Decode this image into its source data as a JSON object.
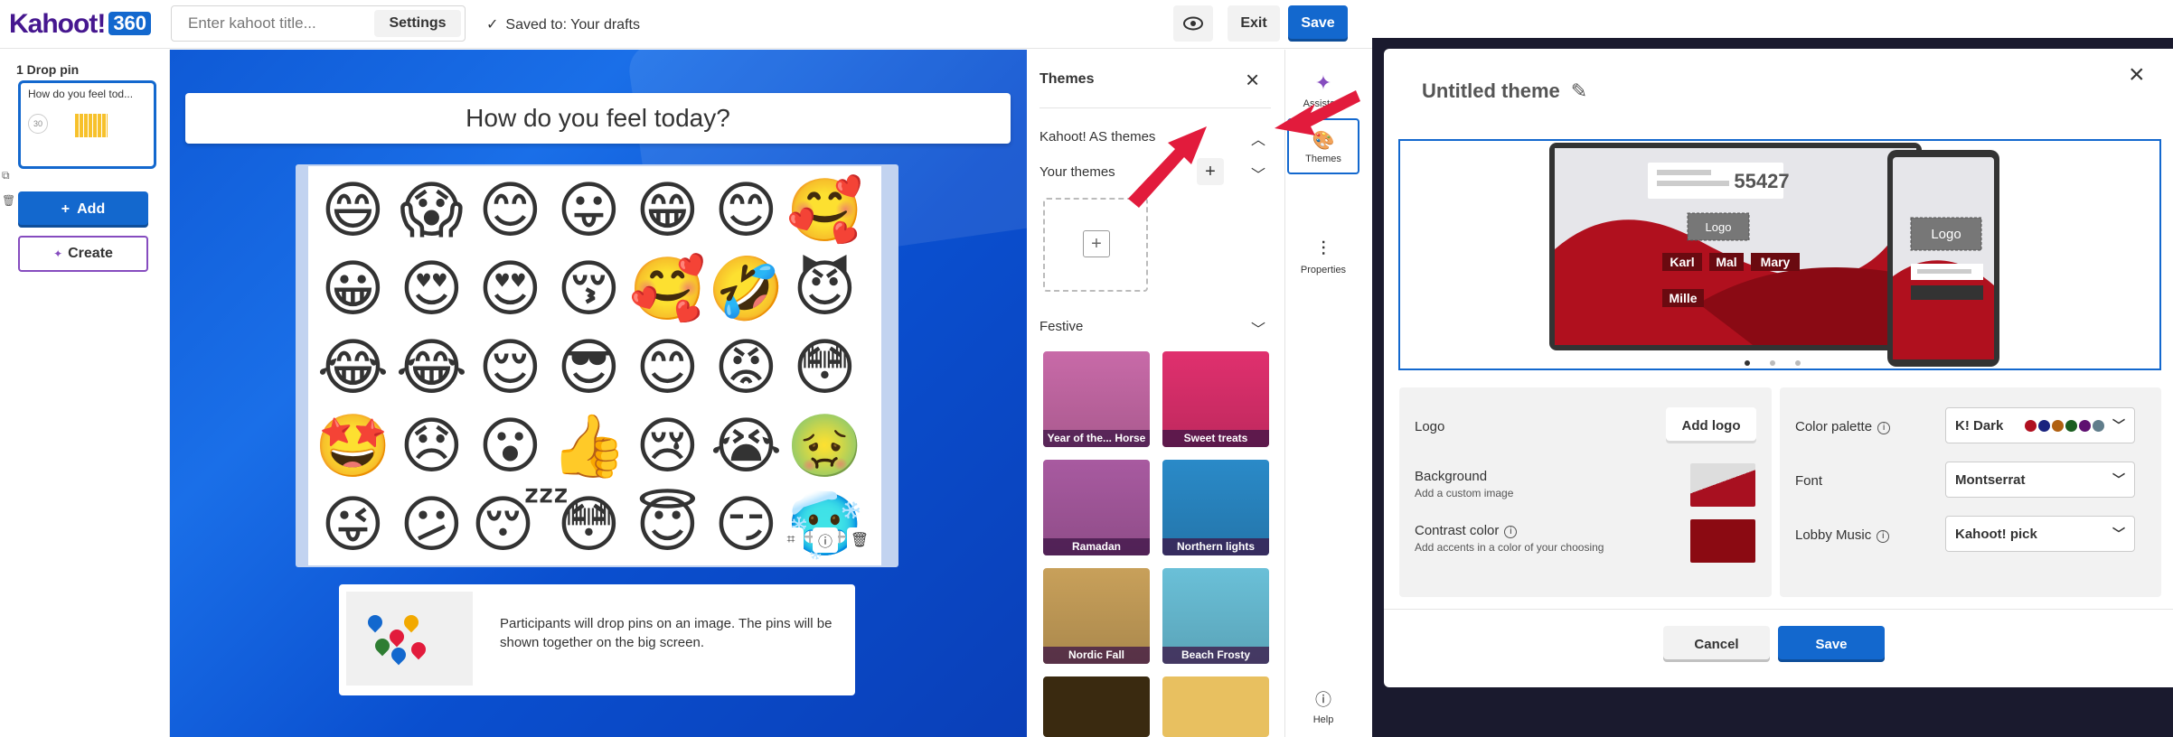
{
  "topbar": {
    "logo_text": "Kahoot!",
    "logo_badge": "360",
    "title_placeholder": "Enter kahoot title...",
    "settings_label": "Settings",
    "saved_text": "Saved to: Your drafts",
    "exit_label": "Exit",
    "save_label": "Save"
  },
  "left_panel": {
    "slide_label": "1  Drop pin",
    "slide_title": "How do you feel tod...",
    "slide_timer": "30",
    "add_label": "Add",
    "create_label": "Create"
  },
  "canvas": {
    "question": "How do you feel today?",
    "emojis": [
      "😄",
      "😱",
      "😊",
      "😛",
      "😁",
      "😊",
      "🥰",
      "😀",
      "😍",
      "😍",
      "😚",
      "🥰",
      "🤣",
      "😈",
      "😂",
      "😂",
      "😌",
      "😎",
      "😊",
      "😡",
      "😳",
      "🤩",
      "😞",
      "😮",
      "👍",
      "😢",
      "😭",
      "🤢",
      "😜",
      "😕",
      "😴",
      "😳",
      "😇",
      "😏",
      "🥶"
    ],
    "info_text": "Participants will drop pins on an image. The pins will be shown together on the big screen."
  },
  "themes_panel": {
    "title": "Themes",
    "kahoot_as_themes": "Kahoot! AS themes",
    "your_themes": "Your themes",
    "festive": "Festive",
    "cards": [
      {
        "label": "Year of the... Horse",
        "color": "#c86aa8"
      },
      {
        "label": "Sweet treats",
        "color": "#e0306e"
      },
      {
        "label": "Ramadan",
        "color": "#a85aa0"
      },
      {
        "label": "Northern lights",
        "color": "#2a8ac8"
      },
      {
        "label": "Nordic Fall",
        "color": "#c8a05a"
      },
      {
        "label": "Beach Frosty",
        "color": "#6ac0d8"
      }
    ]
  },
  "strip": {
    "assistant": "Assistant",
    "themes": "Themes",
    "properties": "Properties",
    "help": "Help"
  },
  "modal": {
    "title": "Untitled theme",
    "preview_code": "55427",
    "preview_logo": "Logo",
    "preview_names": [
      "Karl",
      "Mal",
      "Mary",
      "Mille"
    ],
    "logo_label": "Logo",
    "add_logo": "Add logo",
    "background_label": "Background",
    "background_sub": "Add a custom image",
    "contrast_label": "Contrast color",
    "contrast_sub": "Add accents in a color of your choosing",
    "palette_label": "Color palette",
    "palette_value": "K! Dark",
    "palette_colors": [
      "#b01020",
      "#1a237e",
      "#b06010",
      "#1b5e20",
      "#5e1070",
      "#607d8b"
    ],
    "font_label": "Font",
    "font_value": "Montserrat",
    "music_label": "Lobby Music",
    "music_value": "Kahoot! pick",
    "cancel": "Cancel",
    "save": "Save",
    "accent_color": "#8b0a12"
  }
}
